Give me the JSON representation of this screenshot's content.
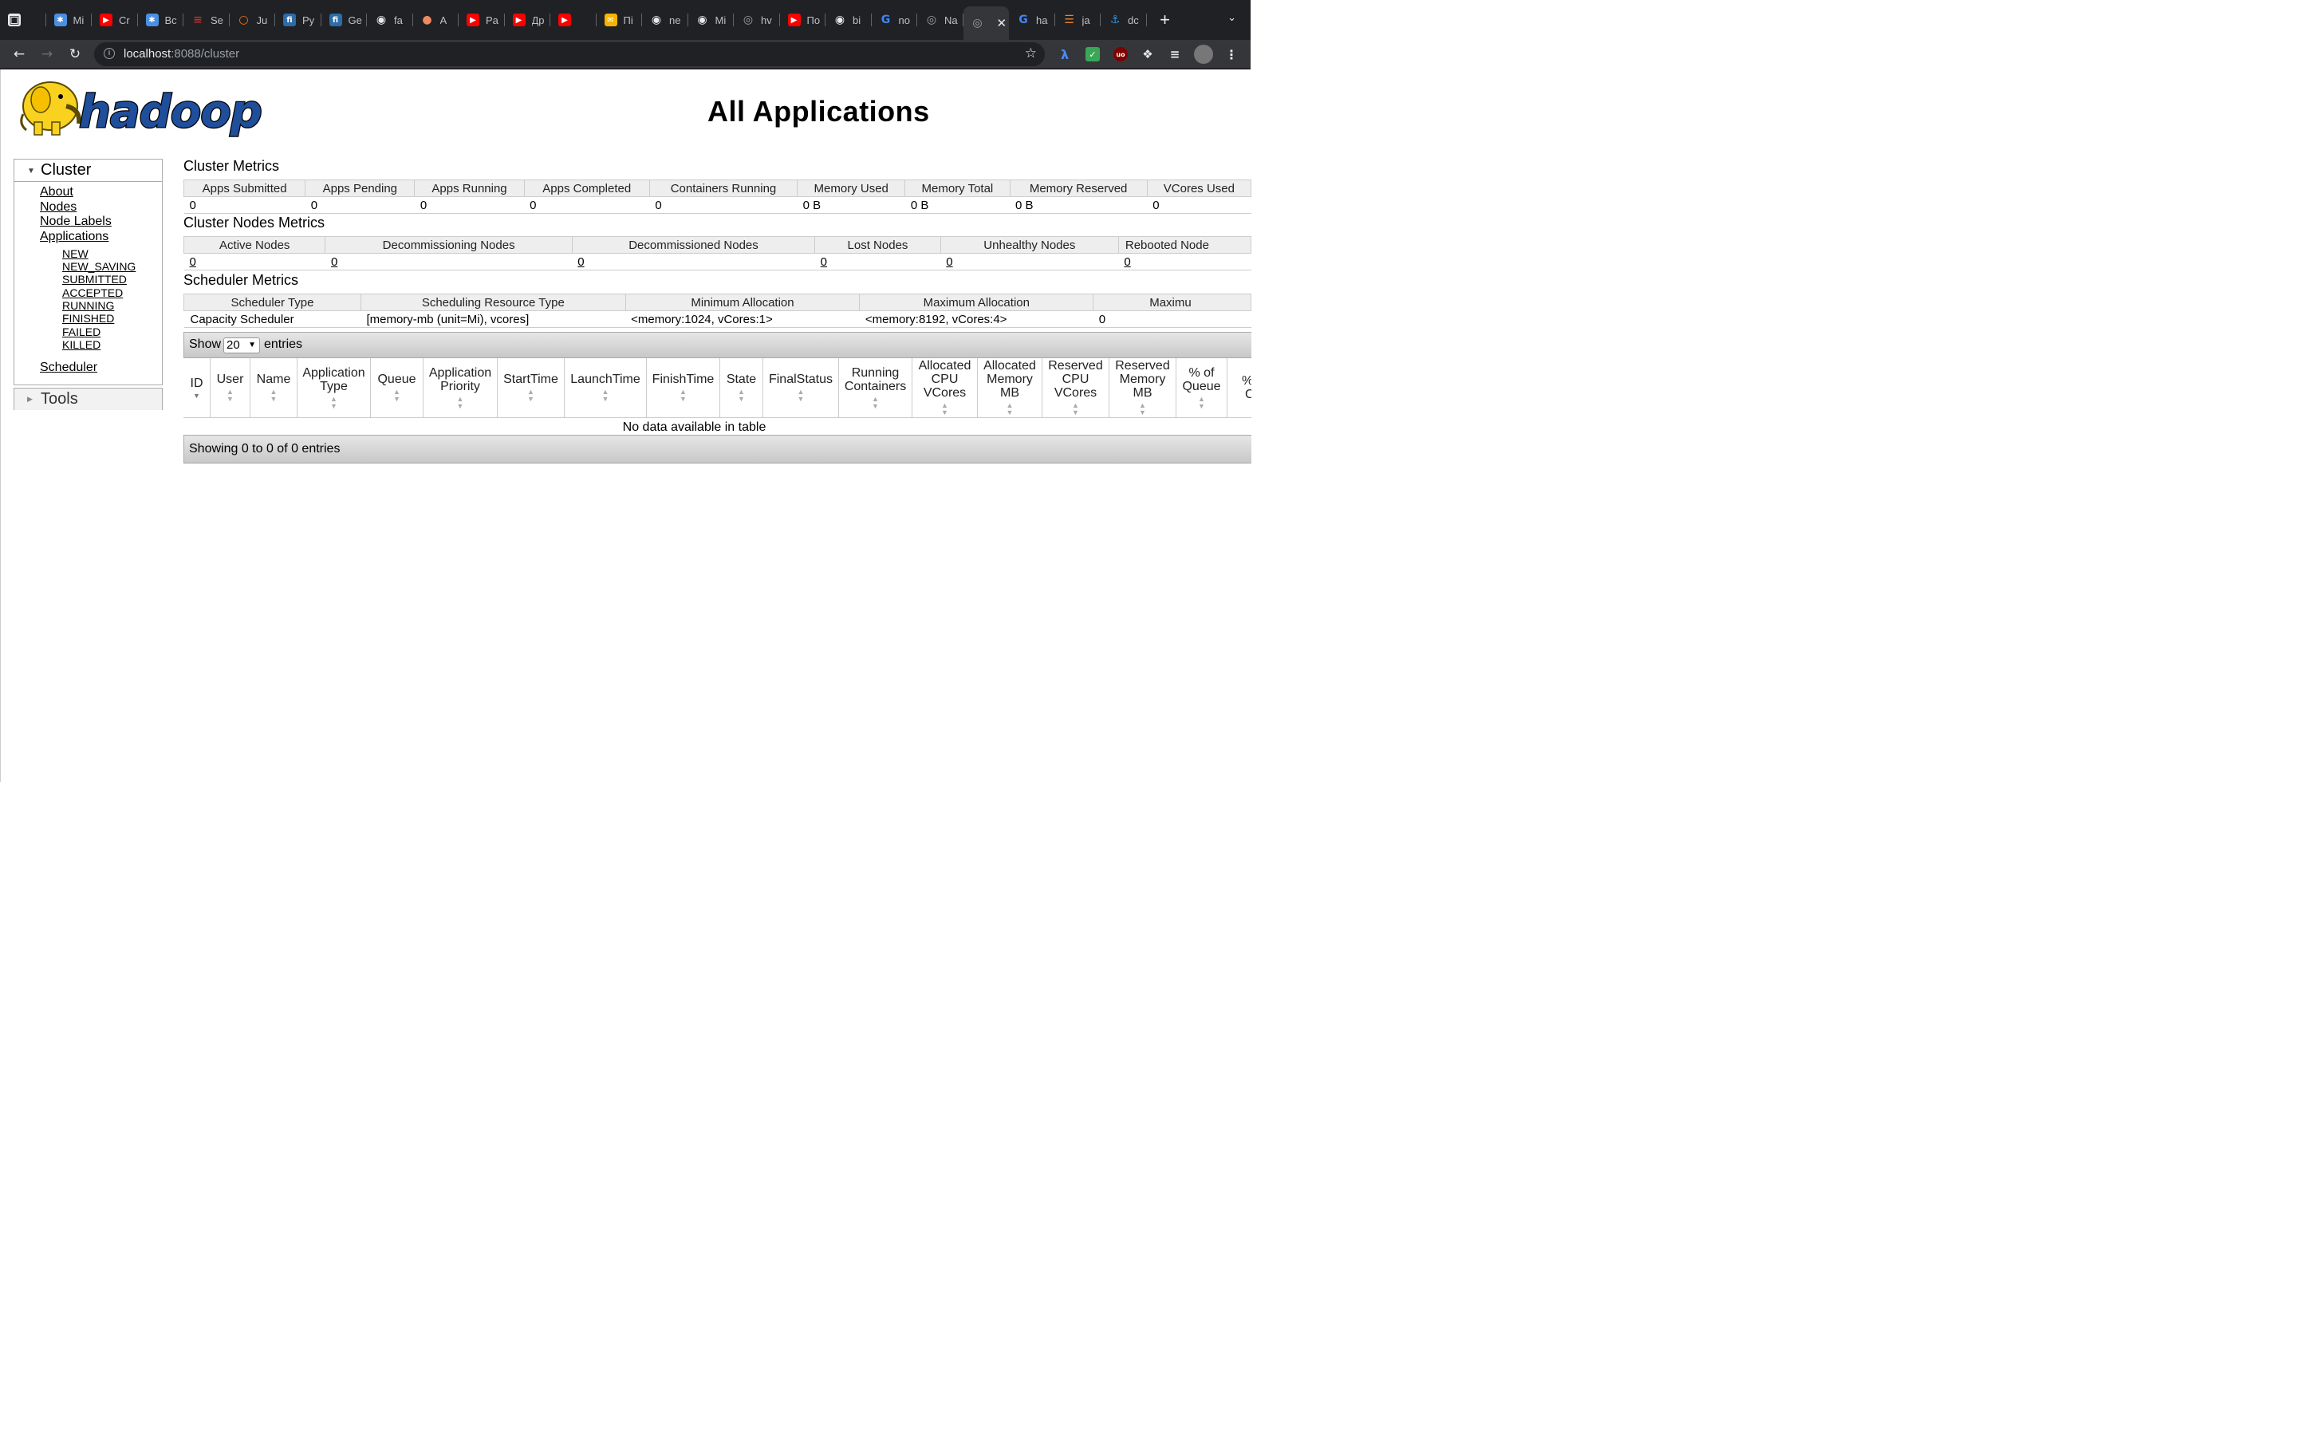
{
  "browser": {
    "tabs": [
      {
        "title": "",
        "icon": "folder-icon",
        "color": "#e8eaed"
      },
      {
        "title": "Mi",
        "icon": "snowflake-icon",
        "color": "#4a90e2"
      },
      {
        "title": "Cr",
        "icon": "youtube-icon",
        "color": "#ff0000"
      },
      {
        "title": "Bc",
        "icon": "snowflake-icon",
        "color": "#4a90e2"
      },
      {
        "title": "Se",
        "icon": "scala-icon",
        "color": "#c72c27"
      },
      {
        "title": "Ju",
        "icon": "jupyter-icon",
        "color": "#f37626"
      },
      {
        "title": "Py",
        "icon": "fastapi-icon",
        "color": "#2c6ca8"
      },
      {
        "title": "Ge",
        "icon": "fastapi-icon",
        "color": "#2c6ca8"
      },
      {
        "title": "fa",
        "icon": "github-icon",
        "color": "#e8eaed"
      },
      {
        "title": "A",
        "icon": "peach-icon",
        "color": "#f08a5d"
      },
      {
        "title": "Pa",
        "icon": "youtube-icon",
        "color": "#ff0000"
      },
      {
        "title": "Др",
        "icon": "youtube-icon",
        "color": "#ff0000"
      },
      {
        "title": "",
        "icon": "youtube-audio-icon",
        "color": "#ff0000"
      },
      {
        "title": "Пі",
        "icon": "mail-icon",
        "color": "#f4b400"
      },
      {
        "title": "ne",
        "icon": "github-icon",
        "color": "#e8eaed"
      },
      {
        "title": "Mi",
        "icon": "github-icon",
        "color": "#e8eaed"
      },
      {
        "title": "hv",
        "icon": "globe-icon",
        "color": "#9aa0a6"
      },
      {
        "title": "По",
        "icon": "youtube-icon",
        "color": "#ff0000"
      },
      {
        "title": "bi",
        "icon": "github-icon",
        "color": "#e8eaed"
      },
      {
        "title": "no",
        "icon": "google-icon",
        "color": "#4285f4"
      },
      {
        "title": "Na",
        "icon": "globe-icon",
        "color": "#9aa0a6"
      },
      {
        "title": "",
        "icon": "globe-icon",
        "color": "#9aa0a6",
        "active": true
      },
      {
        "title": "ha",
        "icon": "google-icon",
        "color": "#4285f4"
      },
      {
        "title": "ja",
        "icon": "stackoverflow-icon",
        "color": "#f48024"
      },
      {
        "title": "dc",
        "icon": "docker-icon",
        "color": "#2496ed"
      }
    ],
    "url_host": "localhost",
    "url_path": ":8088/cluster"
  },
  "header": {
    "logo_text": "hadoop",
    "title": "All Applications"
  },
  "sidebar": {
    "cluster_label": "Cluster",
    "links": [
      "About",
      "Nodes",
      "Node Labels",
      "Applications"
    ],
    "app_states": [
      "NEW",
      "NEW_SAVING",
      "SUBMITTED",
      "ACCEPTED",
      "RUNNING",
      "FINISHED",
      "FAILED",
      "KILLED"
    ],
    "scheduler_link": "Scheduler",
    "tools_label": "Tools"
  },
  "cluster_metrics": {
    "title": "Cluster Metrics",
    "headers": [
      "Apps Submitted",
      "Apps Pending",
      "Apps Running",
      "Apps Completed",
      "Containers Running",
      "Memory Used",
      "Memory Total",
      "Memory Reserved",
      "VCores Used"
    ],
    "values": [
      "0",
      "0",
      "0",
      "0",
      "0",
      "0 B",
      "0 B",
      "0 B",
      "0"
    ]
  },
  "nodes_metrics": {
    "title": "Cluster Nodes Metrics",
    "headers": [
      "Active Nodes",
      "Decommissioning Nodes",
      "Decommissioned Nodes",
      "Lost Nodes",
      "Unhealthy Nodes",
      "Rebooted Node"
    ],
    "values": [
      "0",
      "0",
      "0",
      "0",
      "0",
      "0"
    ]
  },
  "scheduler_metrics": {
    "title": "Scheduler Metrics",
    "headers": [
      "Scheduler Type",
      "Scheduling Resource Type",
      "Minimum Allocation",
      "Maximum Allocation",
      "Maximu"
    ],
    "values": [
      "Capacity Scheduler",
      "[memory-mb (unit=Mi), vcores]",
      "<memory:1024, vCores:1>",
      "<memory:8192, vCores:4>",
      "0"
    ]
  },
  "apps_table": {
    "show_label": "Show",
    "page_length": "20",
    "entries_label": "entries",
    "columns": [
      "ID",
      "User",
      "Name",
      "Application Type",
      "Queue",
      "Application Priority",
      "StartTime",
      "LaunchTime",
      "FinishTime",
      "State",
      "FinalStatus",
      "Running Containers",
      "Allocated CPU VCores",
      "Allocated Memory MB",
      "Reserved CPU VCores",
      "Reserved Memory MB",
      "% of Queue",
      "% of Clu"
    ],
    "empty_text": "No data available in table",
    "footer_text": "Showing 0 to 0 of 0 entries"
  }
}
